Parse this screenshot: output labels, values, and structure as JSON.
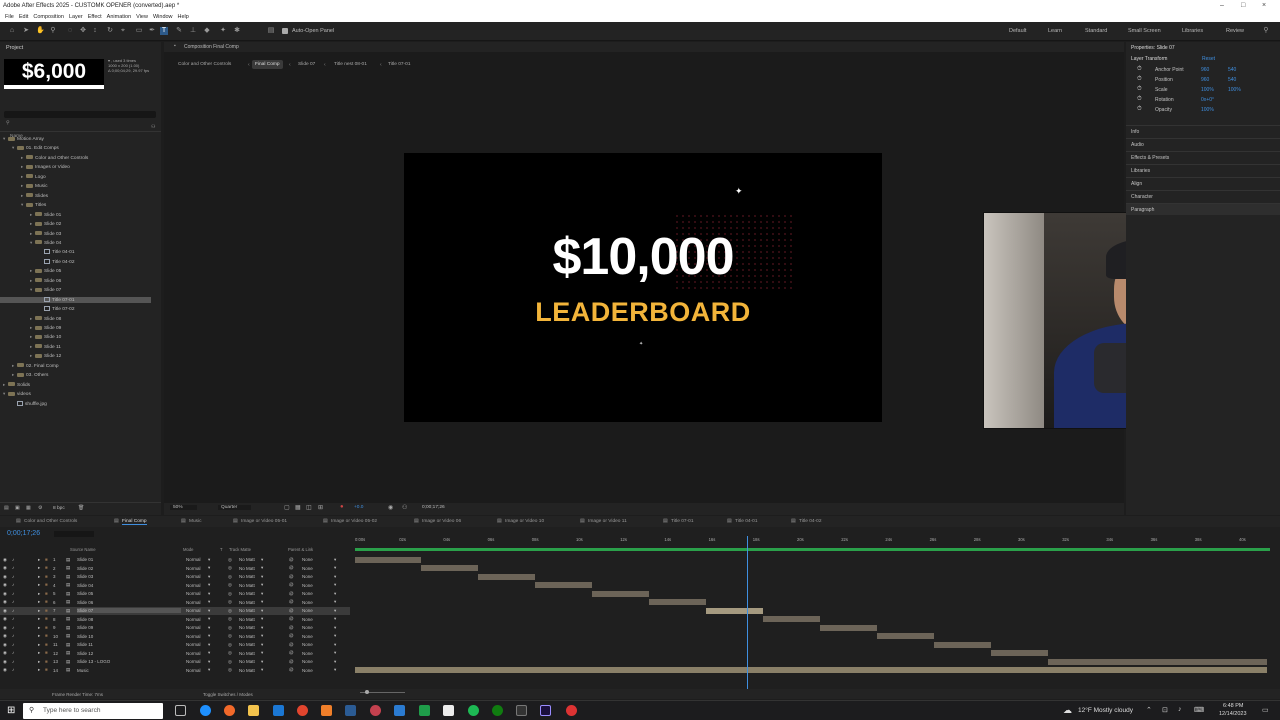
{
  "app": {
    "title": "Adobe After Effects 2025 - CUSTOMK OPENER (converted).aep *",
    "menu": [
      "File",
      "Edit",
      "Composition",
      "Layer",
      "Effect",
      "Animation",
      "View",
      "Window",
      "Help"
    ],
    "window_controls": [
      "–",
      "□",
      "×"
    ]
  },
  "toolbar": {
    "auto_open_panel": "Auto-Open Panel",
    "workspaces": [
      "Default",
      "Learn",
      "Standard",
      "Small Screen",
      "Libraries",
      "Review"
    ]
  },
  "project": {
    "label": "Project",
    "thumb_text": "$6,000",
    "thumb_info": [
      "▾ , used 3 times",
      "1000 x 200 (1.00)",
      "Δ 0;00;04;29, 29.97 fps"
    ],
    "search_placeholder": "",
    "column": "Name",
    "bpc": "8 bpc",
    "tree": [
      {
        "label": "Motion Array",
        "level": 0,
        "kind": "folder",
        "open": true
      },
      {
        "label": "01. Edit Comps",
        "level": 1,
        "kind": "folder",
        "open": true
      },
      {
        "label": "Color and Other Controls",
        "level": 2,
        "kind": "folder"
      },
      {
        "label": "Images or Video",
        "level": 2,
        "kind": "folder"
      },
      {
        "label": "Logo",
        "level": 2,
        "kind": "folder"
      },
      {
        "label": "Music",
        "level": 2,
        "kind": "folder"
      },
      {
        "label": "Slides",
        "level": 2,
        "kind": "folder"
      },
      {
        "label": "Titles",
        "level": 2,
        "kind": "folder",
        "open": true
      },
      {
        "label": "Slide 01",
        "level": 3,
        "kind": "folder"
      },
      {
        "label": "Slide 02",
        "level": 3,
        "kind": "folder"
      },
      {
        "label": "Slide 03",
        "level": 3,
        "kind": "folder"
      },
      {
        "label": "Slide 04",
        "level": 3,
        "kind": "folder",
        "open": true
      },
      {
        "label": "Title 04-01",
        "level": 4,
        "kind": "comp"
      },
      {
        "label": "Title 04-02",
        "level": 4,
        "kind": "comp"
      },
      {
        "label": "Slide 05",
        "level": 3,
        "kind": "folder"
      },
      {
        "label": "Slide 06",
        "level": 3,
        "kind": "folder"
      },
      {
        "label": "Slide 07",
        "level": 3,
        "kind": "folder",
        "open": true
      },
      {
        "label": "Title 07-01",
        "level": 4,
        "kind": "comp",
        "selected": true
      },
      {
        "label": "Title 07-02",
        "level": 4,
        "kind": "comp"
      },
      {
        "label": "Slide 08",
        "level": 3,
        "kind": "folder"
      },
      {
        "label": "Slide 09",
        "level": 3,
        "kind": "folder"
      },
      {
        "label": "Slide 10",
        "level": 3,
        "kind": "folder"
      },
      {
        "label": "Slide 11",
        "level": 3,
        "kind": "folder"
      },
      {
        "label": "Slide 12",
        "level": 3,
        "kind": "folder"
      },
      {
        "label": "02. Final Comp",
        "level": 1,
        "kind": "folder"
      },
      {
        "label": "03. Others",
        "level": 1,
        "kind": "folder"
      },
      {
        "label": "Solids",
        "level": 0,
        "kind": "folder"
      },
      {
        "label": "videos",
        "level": 0,
        "kind": "folder",
        "open": true
      },
      {
        "label": "shuffle.jpg",
        "level": 1,
        "kind": "file"
      }
    ]
  },
  "viewer": {
    "panel_label": "Composition Final Comp",
    "breadcrumbs": [
      "Color and Other Controls",
      "Final Comp",
      "Slide 07",
      "Title nest 08-01",
      "Title 07-01"
    ],
    "big_text": "$10,000",
    "sub_text": "LEADERBOARD",
    "zoom": "50%",
    "quality": "Quarter",
    "exposure": "+0.0",
    "timecode": "0;00;17;26"
  },
  "properties": {
    "title": "Properties: Slide 07",
    "section": "Layer Transform",
    "reset": "Reset",
    "items": [
      {
        "label": "Anchor Point",
        "v1": "960",
        "v2": "540"
      },
      {
        "label": "Position",
        "v1": "960",
        "v2": "540"
      },
      {
        "label": "Scale",
        "v1": "100%",
        "v2": "100%"
      },
      {
        "label": "Rotation",
        "v1": "0x+0°",
        "v2": ""
      },
      {
        "label": "Opacity",
        "v1": "100%",
        "v2": ""
      }
    ],
    "panels": [
      "Info",
      "Audio",
      "Effects & Presets",
      "Libraries",
      "Align",
      "Character",
      "Paragraph"
    ]
  },
  "timeline": {
    "tabs": [
      "Color and Other Controls",
      "Final Comp",
      "Music",
      "Image or Video 05-01",
      "Image or Video 05-02",
      "Image or Video 06",
      "Image or Video 10",
      "Image or Video 11",
      "Title 07-01",
      "Title 04-01",
      "Title 04-02"
    ],
    "timecode": "0;00;17;26",
    "columns": {
      "source": "Source Name",
      "mode": "Mode",
      "t": "T",
      "trkmat": "Track Matte",
      "parent": "Parent & Link"
    },
    "ruler": [
      "0:00s",
      "02s",
      "04s",
      "06s",
      "08s",
      "10s",
      "12s",
      "14s",
      "16s",
      "18s",
      "20s",
      "22s",
      "24s",
      "26s",
      "28s",
      "30s",
      "32s",
      "34s",
      "36s",
      "38s",
      "40s"
    ],
    "layers": [
      {
        "n": "1",
        "name": "Slide 01",
        "start": 0.0,
        "end": 0.072
      },
      {
        "n": "2",
        "name": "Slide 02",
        "start": 0.072,
        "end": 0.135
      },
      {
        "n": "3",
        "name": "Slide 03",
        "start": 0.135,
        "end": 0.197
      },
      {
        "n": "4",
        "name": "Slide 04",
        "start": 0.197,
        "end": 0.26
      },
      {
        "n": "5",
        "name": "Slide 05",
        "start": 0.26,
        "end": 0.322
      },
      {
        "n": "6",
        "name": "Slide 06",
        "start": 0.322,
        "end": 0.385
      },
      {
        "n": "7",
        "name": "Slide 07",
        "start": 0.385,
        "end": 0.447,
        "selected": true
      },
      {
        "n": "8",
        "name": "Slide 08",
        "start": 0.447,
        "end": 0.51
      },
      {
        "n": "9",
        "name": "Slide 09",
        "start": 0.51,
        "end": 0.572
      },
      {
        "n": "10",
        "name": "Slide 10",
        "start": 0.572,
        "end": 0.635
      },
      {
        "n": "11",
        "name": "Slide 11",
        "start": 0.635,
        "end": 0.697
      },
      {
        "n": "12",
        "name": "Slide 12",
        "start": 0.697,
        "end": 0.76
      },
      {
        "n": "13",
        "name": "Slide 13 - LOGO",
        "start": 0.76,
        "end": 1.0
      },
      {
        "n": "14",
        "name": "Music",
        "start": 0.0,
        "end": 1.0
      }
    ],
    "mode_value": "Normal",
    "matte_value": "No Matt",
    "parent_value": "None",
    "footer_left": "Frame Render Time: 7ms",
    "footer_mid": "Toggle Switches / Modes",
    "playhead": 0.43
  },
  "taskbar": {
    "search_placeholder": "Type here to search",
    "weather": "12°F  Mostly cloudy",
    "time": "6:48 PM",
    "date": "12/14/2023"
  }
}
